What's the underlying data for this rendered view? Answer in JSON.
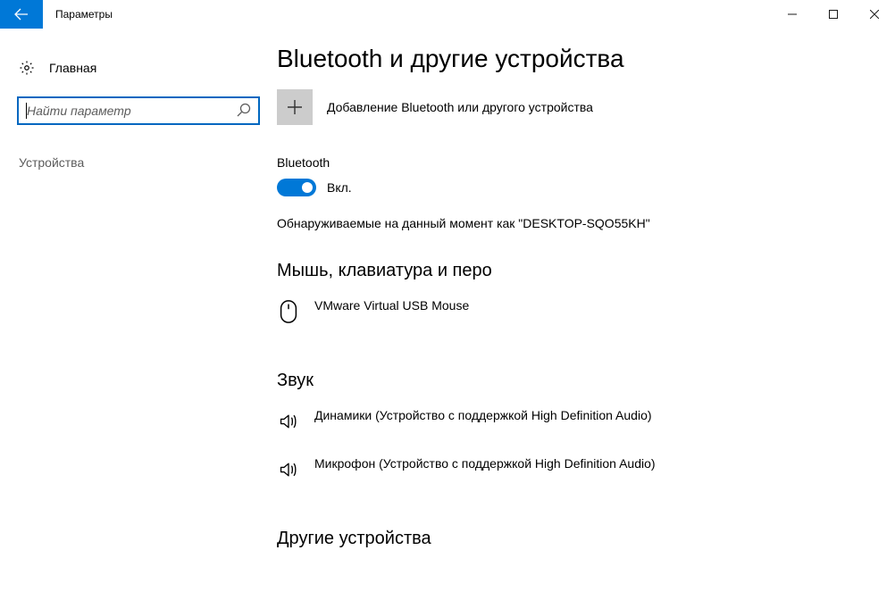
{
  "window": {
    "title": "Параметры"
  },
  "sidebar": {
    "home_label": "Главная",
    "search_placeholder": "Найти параметр",
    "section_label": "Устройства"
  },
  "main": {
    "page_title": "Bluetooth и другие устройства",
    "add_device_label": "Добавление Bluetooth или другого устройства",
    "bluetooth_section_label": "Bluetooth",
    "toggle_state_label": "Вкл.",
    "discoverable_text": "Обнаруживаемые на данный момент как \"DESKTOP-SQO55KH\"",
    "section_mouse_title": "Мышь, клавиатура и перо",
    "devices_mouse": [
      {
        "name": "VMware Virtual USB Mouse",
        "icon": "mouse"
      }
    ],
    "section_sound_title": "Звук",
    "devices_sound": [
      {
        "name": "Динамики (Устройство с поддержкой High Definition Audio)",
        "icon": "speaker"
      },
      {
        "name": "Микрофон (Устройство с поддержкой High Definition Audio)",
        "icon": "speaker"
      }
    ],
    "section_other_title": "Другие устройства"
  }
}
